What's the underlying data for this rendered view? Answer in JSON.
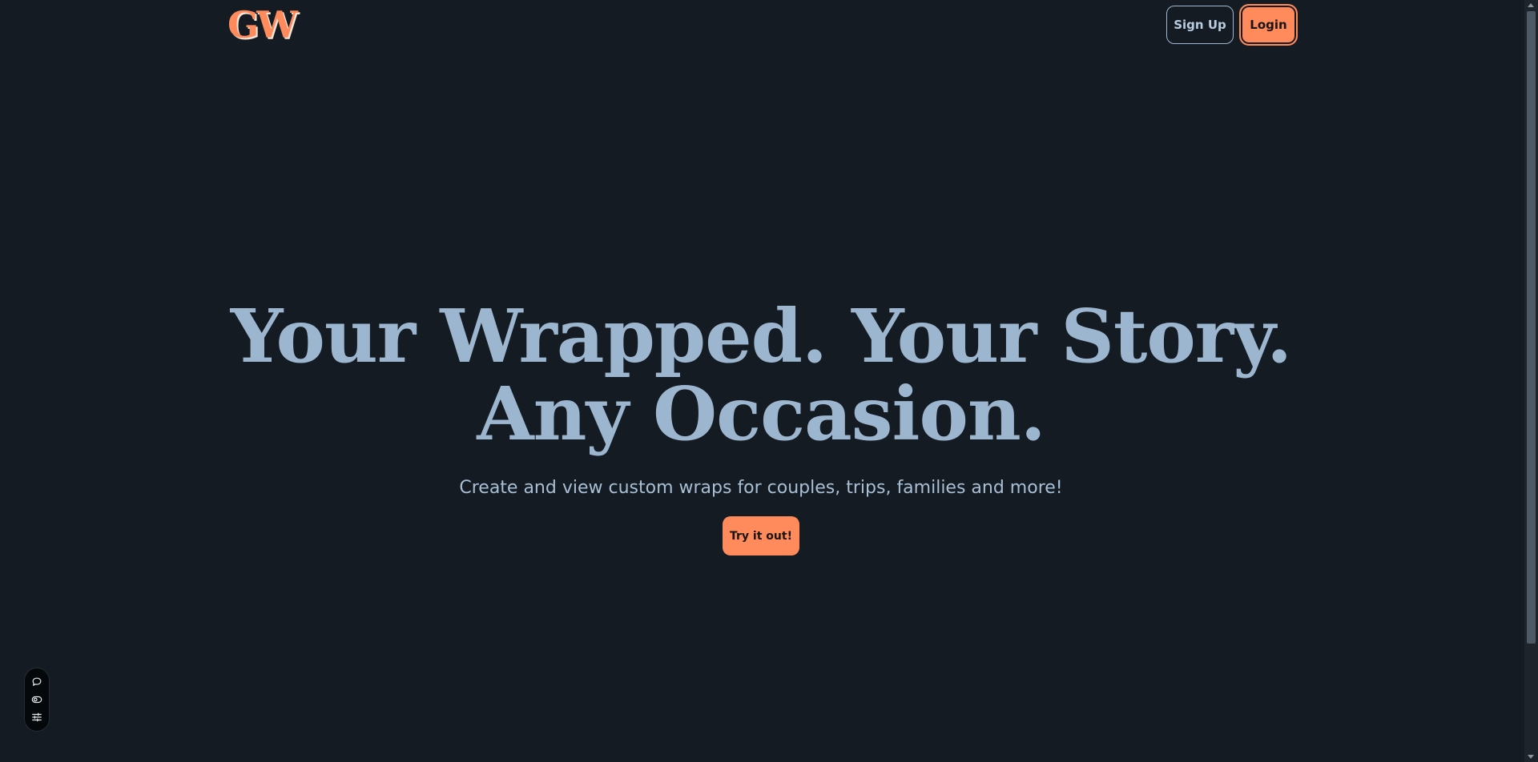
{
  "header": {
    "logo": "GW",
    "signup_label": "Sign Up",
    "login_label": "Login"
  },
  "hero": {
    "title_line1": "Your Wrapped. Your Story.",
    "title_line2": "Any Occasion.",
    "subtitle": "Create and view custom wraps for couples, trips, families and more!",
    "cta_label": "Try it out!"
  },
  "dock": {
    "icons": [
      "chat-bubble-icon",
      "eye-toggle-icon",
      "settings-sliders-icon"
    ]
  },
  "colors": {
    "background": "#141b22",
    "accent": "#ff8a5c",
    "heading": "#9db6cf",
    "text": "#a8bfd5"
  }
}
